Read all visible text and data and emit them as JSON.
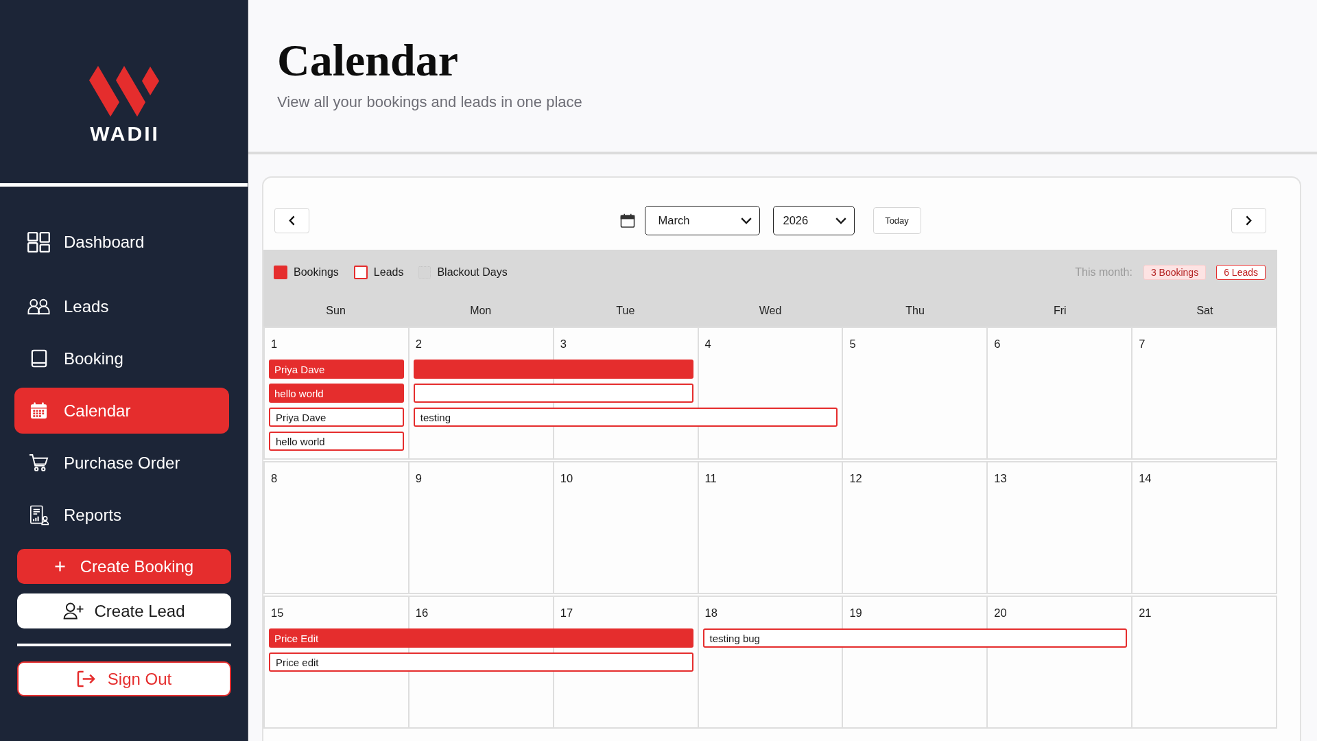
{
  "sidebar": {
    "brand": "WADII",
    "nav_items": [
      {
        "kind": "dashboard",
        "label": "Dashboard",
        "selected": false
      },
      {
        "kind": "leads",
        "label": "Leads",
        "selected": false
      },
      {
        "kind": "booking",
        "label": "Booking",
        "selected": false
      },
      {
        "kind": "calendar",
        "label": "Calendar",
        "selected": true
      },
      {
        "kind": "purchase_order",
        "label": "Purchase Order",
        "selected": false
      },
      {
        "kind": "reports",
        "label": "Reports",
        "selected": false
      }
    ],
    "actions": [
      {
        "kind": "create_booking",
        "label": "Create Booking"
      },
      {
        "kind": "create_lead",
        "label": "Create Lead"
      }
    ],
    "sign_out": {
      "label": "Sign Out"
    }
  },
  "header": {
    "title": "Calendar",
    "subtitle": "View all your bookings and leads in one place"
  },
  "calendar": {
    "month": "March",
    "year": "2026",
    "today_button": "Today",
    "legend": [
      {
        "kind": "booking",
        "label": "Bookings"
      },
      {
        "kind": "lead",
        "label": "Leads"
      },
      {
        "kind": "blackout",
        "label": "Blackout Days"
      }
    ],
    "summary_label": "This month:",
    "summary_badges": [
      {
        "kind": "booking",
        "label": "3 Bookings"
      },
      {
        "kind": "lead",
        "label": "6 Leads"
      }
    ],
    "weekdays": [
      "Sun",
      "Mon",
      "Tue",
      "Wed",
      "Thu",
      "Fri",
      "Sat"
    ],
    "weeks": [
      {
        "days": [
          {
            "date": "1",
            "events": [
              {
                "kind": "booking_1_day",
                "label": "Priya Dave"
              },
              {
                "kind": "booking_1_day",
                "label": "hello world"
              },
              {
                "kind": "lead_1_day",
                "label": "Priya Dave"
              },
              {
                "kind": "lead_1_day",
                "label": "hello world"
              }
            ]
          },
          {
            "date": "2",
            "events": [
              {
                "kind": "booking_2_days"
              },
              {
                "kind": "lead_2_days"
              },
              {
                "kind": "lead_3_days",
                "label": "testing"
              }
            ]
          },
          {
            "date": "3"
          },
          {
            "date": "4"
          },
          {
            "date": "5"
          },
          {
            "date": "6"
          },
          {
            "date": "7"
          }
        ]
      },
      {
        "days": [
          {
            "date": "8"
          },
          {
            "date": "9"
          },
          {
            "date": "10"
          },
          {
            "date": "11"
          },
          {
            "date": "12"
          },
          {
            "date": "13"
          },
          {
            "date": "14"
          }
        ]
      },
      {
        "days": [
          {
            "date": "15",
            "events": [
              {
                "kind": "booking_3_days",
                "label": "Price Edit"
              },
              {
                "kind": "lead_3_days",
                "label": "Price edit"
              }
            ]
          },
          {
            "date": "16"
          },
          {
            "date": "17"
          },
          {
            "date": "18",
            "events": [
              {
                "kind": "lead_3_days",
                "label": "testing bug"
              }
            ]
          },
          {
            "date": "19"
          },
          {
            "date": "20"
          },
          {
            "date": "21"
          }
        ]
      }
    ]
  }
}
